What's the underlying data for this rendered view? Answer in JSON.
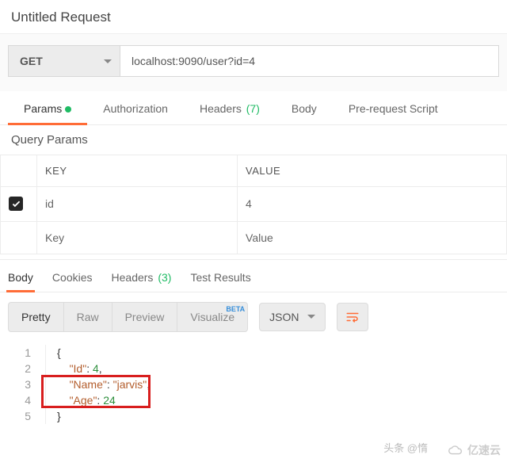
{
  "title": "Untitled Request",
  "method": "GET",
  "url": "localhost:9090/user?id=4",
  "tabs": {
    "params": "Params",
    "auth": "Authorization",
    "headers": "Headers",
    "headers_count": "(7)",
    "body": "Body",
    "prerequest": "Pre-request Script"
  },
  "query": {
    "heading": "Query Params",
    "key_h": "KEY",
    "value_h": "VALUE",
    "rows": [
      {
        "key": "id",
        "value": "4"
      }
    ],
    "key_ph": "Key",
    "value_ph": "Value"
  },
  "resp_tabs": {
    "body": "Body",
    "cookies": "Cookies",
    "headers": "Headers",
    "headers_count": "(3)",
    "tests": "Test Results"
  },
  "view": {
    "pretty": "Pretty",
    "raw": "Raw",
    "preview": "Preview",
    "visualize": "Visualize",
    "beta": "BETA",
    "format": "JSON"
  },
  "json_lines": {
    "l1": "{",
    "l2_k": "\"Id\"",
    "l2_v": "4",
    "l3_k": "\"Name\"",
    "l3_v": "\"jarvis\"",
    "l4_k": "\"Age\"",
    "l4_v": "24",
    "l5": "}"
  },
  "wm1": "头条 @惰",
  "wm2": "亿速云"
}
